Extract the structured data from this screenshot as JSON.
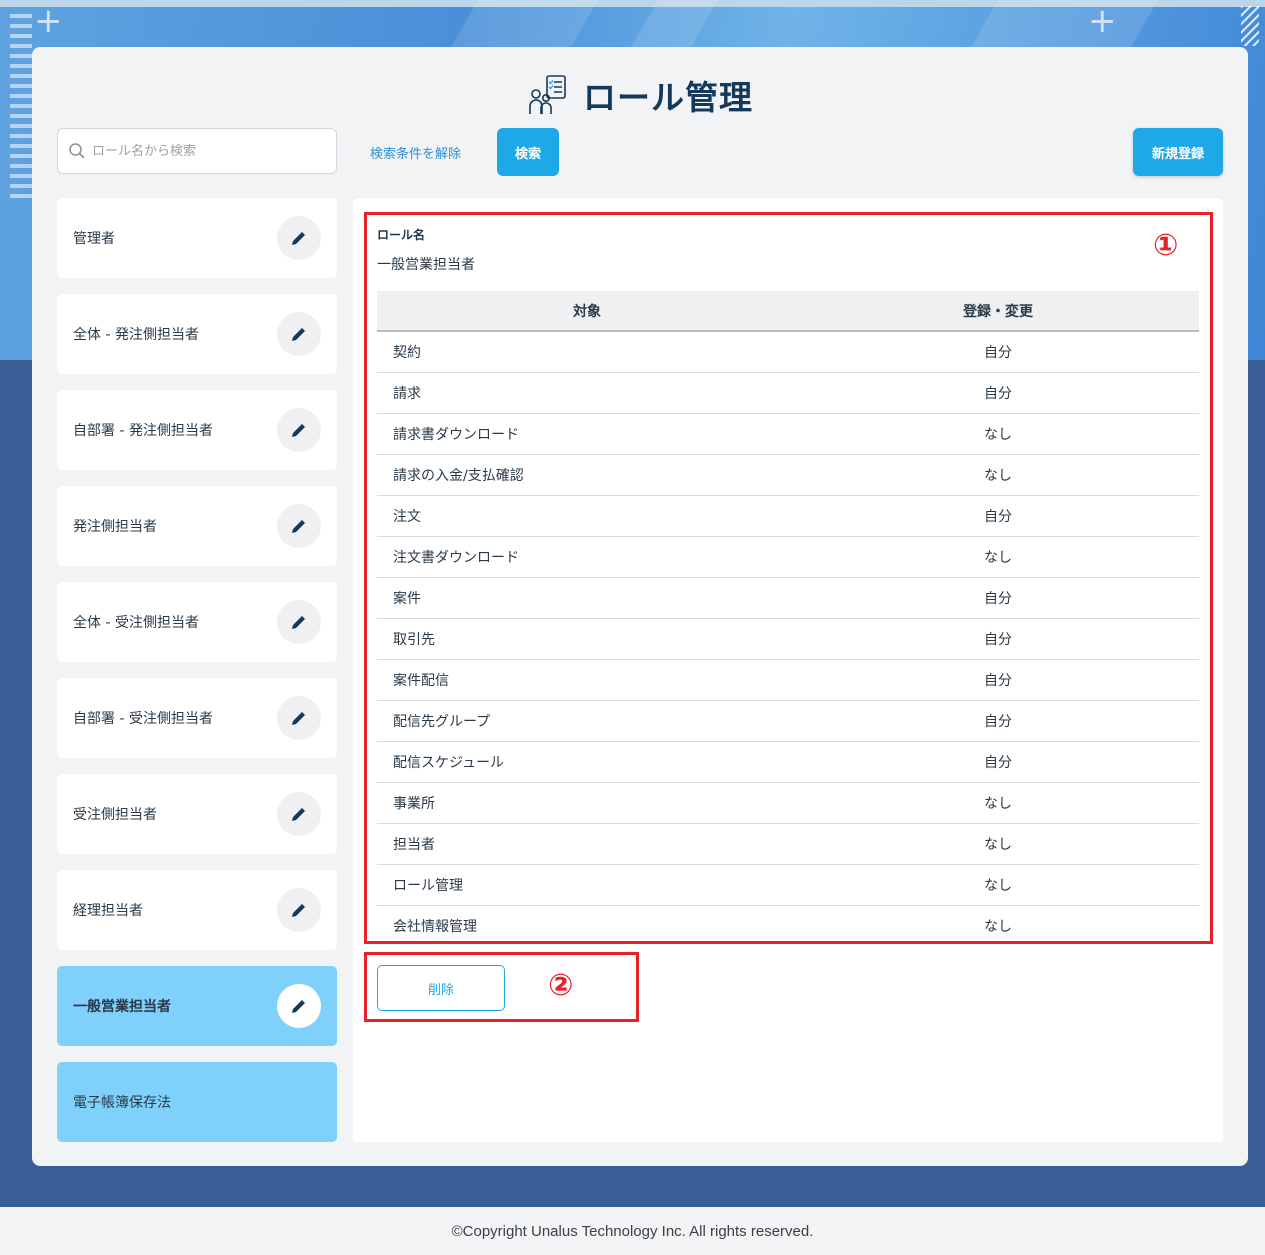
{
  "header": {
    "title": "ロール管理",
    "icon": "role-management-icon"
  },
  "search": {
    "placeholder": "ロール名から検索",
    "value": "",
    "clear_label": "検索条件を解除",
    "search_label": "検索"
  },
  "toolbar": {
    "new_label": "新規登録"
  },
  "roles": [
    {
      "label": "管理者"
    },
    {
      "label": "全体 - 発注側担当者"
    },
    {
      "label": "自部署 - 発注側担当者"
    },
    {
      "label": "発注側担当者"
    },
    {
      "label": "全体 - 受注側担当者"
    },
    {
      "label": "自部署 - 受注側担当者"
    },
    {
      "label": "受注側担当者"
    },
    {
      "label": "経理担当者"
    },
    {
      "label": "一般営業担当者"
    },
    {
      "label": "電子帳簿保存法"
    }
  ],
  "detail": {
    "role_name_label": "ロール名",
    "role_name_value": "一般営業担当者",
    "table": {
      "headers": [
        "対象",
        "登録・変更"
      ],
      "rows": [
        {
          "target": "契約",
          "permission": "自分"
        },
        {
          "target": "請求",
          "permission": "自分"
        },
        {
          "target": "請求書ダウンロード",
          "permission": "なし"
        },
        {
          "target": "請求の入金/支払確認",
          "permission": "なし"
        },
        {
          "target": "注文",
          "permission": "自分"
        },
        {
          "target": "注文書ダウンロード",
          "permission": "なし"
        },
        {
          "target": "案件",
          "permission": "自分"
        },
        {
          "target": "取引先",
          "permission": "自分"
        },
        {
          "target": "案件配信",
          "permission": "自分"
        },
        {
          "target": "配信先グループ",
          "permission": "自分"
        },
        {
          "target": "配信スケジュール",
          "permission": "自分"
        },
        {
          "target": "事業所",
          "permission": "なし"
        },
        {
          "target": "担当者",
          "permission": "なし"
        },
        {
          "target": "ロール管理",
          "permission": "なし"
        },
        {
          "target": "会社情報管理",
          "permission": "なし"
        }
      ]
    },
    "delete_label": "削除"
  },
  "annotations": {
    "marker_1": "①",
    "marker_2": "②",
    "color": "#e8202a"
  },
  "colors": {
    "accent": "#1ea8e8",
    "active_item": "#7fd0fb",
    "title": "#14395b"
  },
  "footer": {
    "copyright": "©Copyright Unalus Technology Inc. All rights reserved."
  }
}
